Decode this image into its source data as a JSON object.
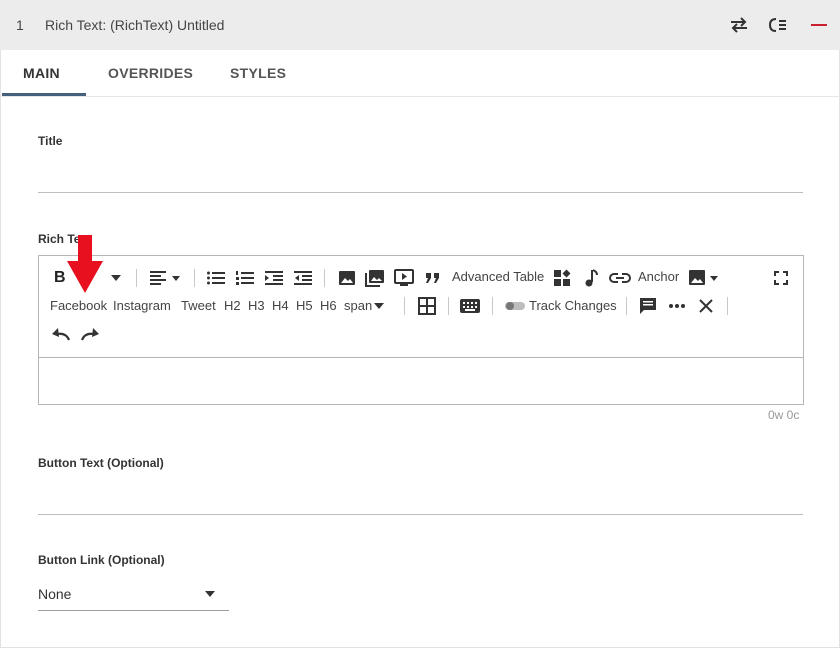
{
  "header": {
    "index": "1",
    "title": "Rich Text: (RichText) Untitled"
  },
  "tabs": [
    {
      "label": "MAIN"
    },
    {
      "label": "OVERRIDES"
    },
    {
      "label": "STYLES"
    }
  ],
  "fields": {
    "title": {
      "label": "Title"
    },
    "rich_text": {
      "label": "Rich Text",
      "counter": "0w 0c"
    },
    "button_text": {
      "label": "Button Text (Optional)"
    },
    "button_link": {
      "label": "Button Link (Optional)",
      "value": "None"
    }
  },
  "toolbar": {
    "bold": "B",
    "advanced_table": "Advanced Table",
    "anchor": "Anchor",
    "facebook": "Facebook",
    "instagram": "Instagram",
    "tweet": "Tweet",
    "headings": [
      "H2",
      "H3",
      "H4",
      "H5",
      "H6"
    ],
    "span": "span",
    "track_changes": "Track Changes"
  },
  "colors": {
    "accent": "#44607a",
    "remove": "#cc1f2d",
    "annotation_arrow": "#e8101e"
  }
}
